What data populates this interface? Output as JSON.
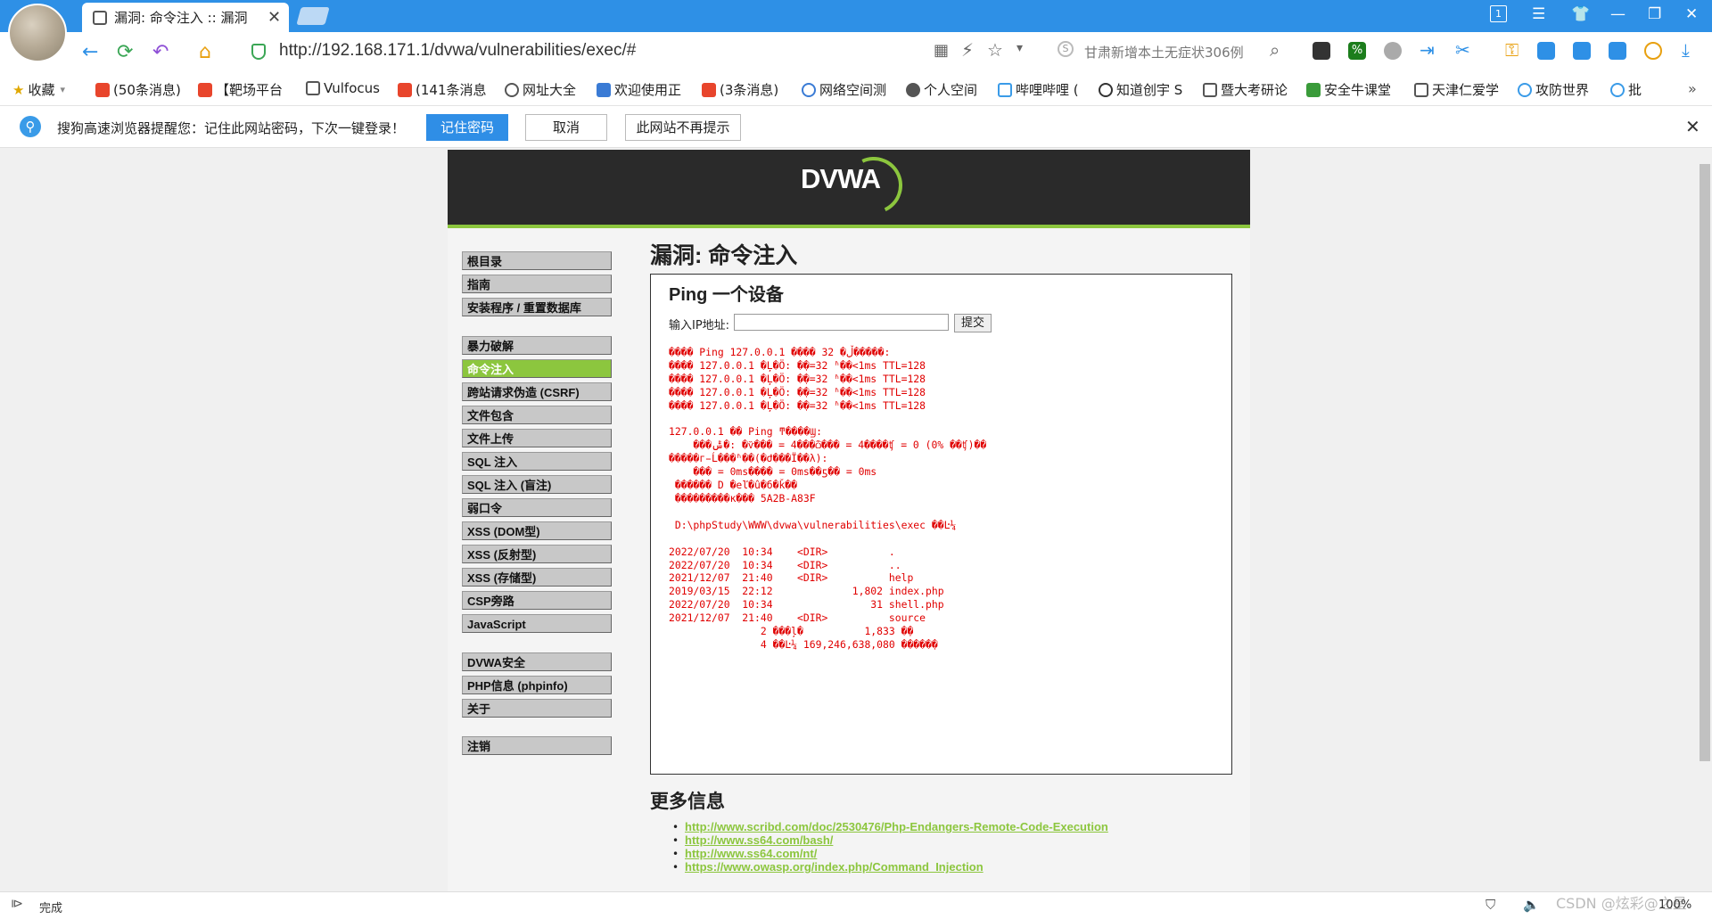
{
  "browser": {
    "tab_title": "漏洞: 命令注入 :: 漏洞",
    "url": "http://192.168.171.1/dvwa/vulnerabilities/exec/#",
    "search_hint": "甘肃新增本土无症状306例",
    "win_badge": "1"
  },
  "bookmarks": [
    {
      "label": "收藏",
      "color": "#e0a800"
    },
    {
      "label": "(50条消息)",
      "color": "#e8452c"
    },
    {
      "label": "【靶场平台",
      "color": "#e8452c"
    },
    {
      "label": "Vulfocus",
      "color": "#555555"
    },
    {
      "label": "(141条消息",
      "color": "#e8452c"
    },
    {
      "label": "网址大全",
      "color": "#555555"
    },
    {
      "label": "欢迎使用正",
      "color": "#3a7bd5"
    },
    {
      "label": "(3条消息)",
      "color": "#e8452c"
    },
    {
      "label": "网络空间测",
      "color": "#3a7bd5"
    },
    {
      "label": "个人空间",
      "color": "#555555"
    },
    {
      "label": "哔哩哔哩 (",
      "color": "#3a9be8"
    },
    {
      "label": "知道创宇 S",
      "color": "#333333"
    },
    {
      "label": "暨大考研论",
      "color": "#555555"
    },
    {
      "label": "安全牛课堂",
      "color": "#3a9b3a"
    },
    {
      "label": "天津仁爱学",
      "color": "#555555"
    },
    {
      "label": "攻防世界",
      "color": "#3a9be8"
    },
    {
      "label": "批",
      "color": "#3a9be8"
    }
  ],
  "notice": {
    "text": "搜狗高速浏览器提醒您：记住此网站密码，下次一键登录！",
    "remember": "记住密码",
    "cancel": "取消",
    "never": "此网站不再提示"
  },
  "dvwa": {
    "logo": "DVWA",
    "page_title": "漏洞: 命令注入",
    "menu": [
      {
        "label": "根目录",
        "active": false
      },
      {
        "label": "指南",
        "active": false
      },
      {
        "label": "安装程序 / 重置数据库",
        "active": false
      },
      {
        "label": "暴力破解",
        "active": false
      },
      {
        "label": "命令注入",
        "active": true
      },
      {
        "label": "跨站请求伪造 (CSRF)",
        "active": false
      },
      {
        "label": "文件包含",
        "active": false
      },
      {
        "label": "文件上传",
        "active": false
      },
      {
        "label": "SQL 注入",
        "active": false
      },
      {
        "label": "SQL 注入 (盲注)",
        "active": false
      },
      {
        "label": "弱口令",
        "active": false
      },
      {
        "label": "XSS (DOM型)",
        "active": false
      },
      {
        "label": "XSS (反射型)",
        "active": false
      },
      {
        "label": "XSS (存储型)",
        "active": false
      },
      {
        "label": "CSP旁路",
        "active": false
      },
      {
        "label": "JavaScript",
        "active": false
      },
      {
        "label": "DVWA安全",
        "active": false
      },
      {
        "label": "PHP信息 (phpinfo)",
        "active": false
      },
      {
        "label": "关于",
        "active": false
      },
      {
        "label": "注销",
        "active": false
      }
    ],
    "ping": {
      "title": "Ping 一个设备",
      "ip_label": "输入IP地址:",
      "ip_value": "",
      "submit": "提交",
      "output": "���� Ping 127.0.0.1 ���� 32 �ֽڵ�����:\n���� 127.0.0.1 �Ļ�Ӧ: �ֽ�=32 ʱ��<1ms TTL=128\n���� 127.0.0.1 �Ļ�Ӧ: �ֽ�=32 ʱ��<1ms TTL=128\n���� 127.0.0.1 �Ļ�Ӧ: �ֽ�=32 ʱ��<1ms TTL=128\n���� 127.0.0.1 �Ļ�Ӧ: �ֽ�=32 ʱ��<1ms TTL=128\n\n127.0.0.1 �� Ping ͳ����Ϣ:\n    ���ݰ�: �ѷ��� = 4���ѽ��� = 4����ʧ = 0 (0% ��ʧ)��\n�����г̵Ĺ���ʱ��(�Ժ���Ϊ��λ):\n    ��� = 0ms���� = 0ms��ƽ�� = 0ms\n ������ D �еľ�û�б�ǩ��\n ���������к��� 5A2B-A83F\n\n D:\\phpStudy\\WWW\\dvwa\\vulnerabilities\\exec ��Ŀ¼\n\n2022/07/20  10:34    <DIR>          .\n2022/07/20  10:34    <DIR>          ..\n2021/12/07  21:40    <DIR>          help\n2019/03/15  22:12             1,802 index.php\n2022/07/20  10:34                31 shell.php\n2021/12/07  21:40    <DIR>          source\n               2 ���ļ�          1,833 �ֽ�\n               4 ��Ŀ¼ 169,246,638,080 �����ֽ�"
    },
    "more_title": "更多信息",
    "links": [
      "http://www.scribd.com/doc/2530476/Php-Endangers-Remote-Code-Execution",
      "http://www.ss64.com/bash/",
      "http://www.ss64.com/nt/",
      "https://www.owasp.org/index.php/Command_Injection"
    ]
  },
  "status": {
    "text": "完成",
    "watermark": "CSDN @炫彩@之星",
    "zoom": "100%"
  }
}
